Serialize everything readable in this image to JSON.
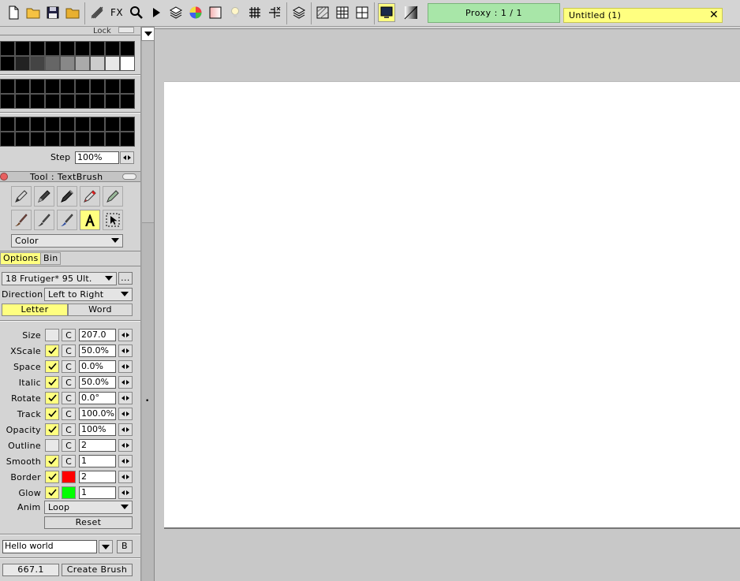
{
  "toolbar": {
    "fx_label": "FX",
    "proxy_label": "Proxy : 1 / 1",
    "document_tab": "Untitled (1)",
    "close_symbol": "✕"
  },
  "panel": {
    "lock_label": "Lock",
    "step_label": "Step",
    "step_value": "100%",
    "tool_title": "Tool : TextBrush",
    "mode_value": "Color",
    "tabs": {
      "options": "Options",
      "bin": "Bin"
    },
    "font_value": "18 Frutiger* 95 Ult.",
    "font_more": "...",
    "direction_label": "Direction",
    "direction_value": "Left to Right",
    "letter_label": "Letter",
    "word_label": "Word",
    "params": [
      {
        "label": "Size",
        "checked": false,
        "value": "207.0",
        "extra": "C"
      },
      {
        "label": "XScale",
        "checked": true,
        "value": "50.0%",
        "extra": "C"
      },
      {
        "label": "Space",
        "checked": true,
        "value": "0.0%",
        "extra": "C"
      },
      {
        "label": "Italic",
        "checked": true,
        "value": "50.0%",
        "extra": "C"
      },
      {
        "label": "Rotate",
        "checked": true,
        "value": "0.0°",
        "extra": "C"
      },
      {
        "label": "Track",
        "checked": true,
        "value": "100.0%",
        "extra": "C"
      },
      {
        "label": "Opacity",
        "checked": true,
        "value": "100%",
        "extra": "C"
      },
      {
        "label": "Outline",
        "checked": false,
        "value": "2",
        "extra": "C"
      },
      {
        "label": "Smooth",
        "checked": true,
        "value": "1",
        "extra": "C"
      },
      {
        "label": "Border",
        "checked": true,
        "value": "2",
        "color": "#ff0000"
      },
      {
        "label": "Glow",
        "checked": true,
        "value": "1",
        "color": "#00ff00"
      }
    ],
    "anim_label": "Anim",
    "anim_value": "Loop",
    "reset_label": "Reset",
    "text_value": "Hello world",
    "bold_label": "B",
    "readout_value": "667.1",
    "create_brush_label": "Create Brush"
  },
  "colors": {
    "proxy_bg": "#a8e6a8",
    "tab_active": "#ffff80",
    "canvas": "#ffffff"
  }
}
